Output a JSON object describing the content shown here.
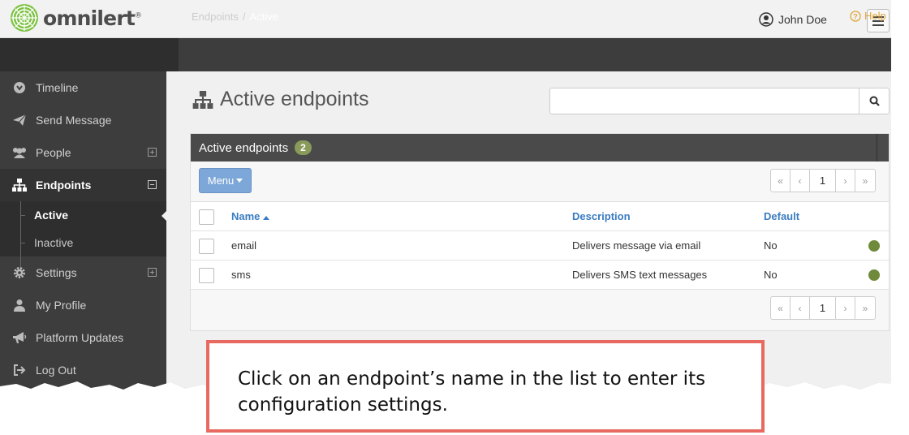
{
  "app": {
    "brand": "omnilert",
    "registered_mark": "®"
  },
  "header": {
    "user_name": "John Doe",
    "user_icon": "user-circle-icon",
    "menu_icon": "hamburger-icon"
  },
  "breadcrumb": {
    "parent": "Endpoints",
    "separator": "/",
    "current": "Active",
    "help_label": "Help"
  },
  "sidebar": {
    "items": [
      {
        "label": "Timeline",
        "icon": "timeline-icon"
      },
      {
        "label": "Send Message",
        "icon": "paper-plane-icon"
      },
      {
        "label": "People",
        "icon": "people-icon",
        "expandable": true
      },
      {
        "label": "Endpoints",
        "icon": "sitemap-icon",
        "expanded": true,
        "active": true
      },
      {
        "label": "Settings",
        "icon": "gear-icon",
        "expandable": true
      },
      {
        "label": "My Profile",
        "icon": "user-icon"
      },
      {
        "label": "Platform Updates",
        "icon": "megaphone-icon"
      },
      {
        "label": "Log Out",
        "icon": "logout-icon"
      }
    ],
    "subitems": [
      {
        "label": "Active",
        "active": true
      },
      {
        "label": "Inactive"
      }
    ]
  },
  "page": {
    "title": "Active endpoints",
    "title_icon": "sitemap-icon",
    "search_placeholder": "",
    "search_icon": "search-icon"
  },
  "panel": {
    "title": "Active endpoints",
    "count": "2",
    "menu_label": "Menu",
    "pager": {
      "first": "«",
      "prev": "‹",
      "page": "1",
      "next": "›",
      "last": "»"
    },
    "columns": {
      "name": "Name",
      "description": "Description",
      "default": "Default"
    },
    "rows": [
      {
        "name": "email",
        "description": "Delivers message via email",
        "default": "No"
      },
      {
        "name": "sms",
        "description": "Delivers SMS text messages",
        "default": "No"
      }
    ]
  },
  "callout": {
    "text": "Click on an endpoint’s name in the list to enter its configuration settings."
  },
  "colors": {
    "accent_blue": "#3a7cc1",
    "badge_green": "#8a9a5b",
    "status_green": "#6e8a3a",
    "help_orange": "#e0a53a",
    "callout_border": "#e8695f"
  }
}
